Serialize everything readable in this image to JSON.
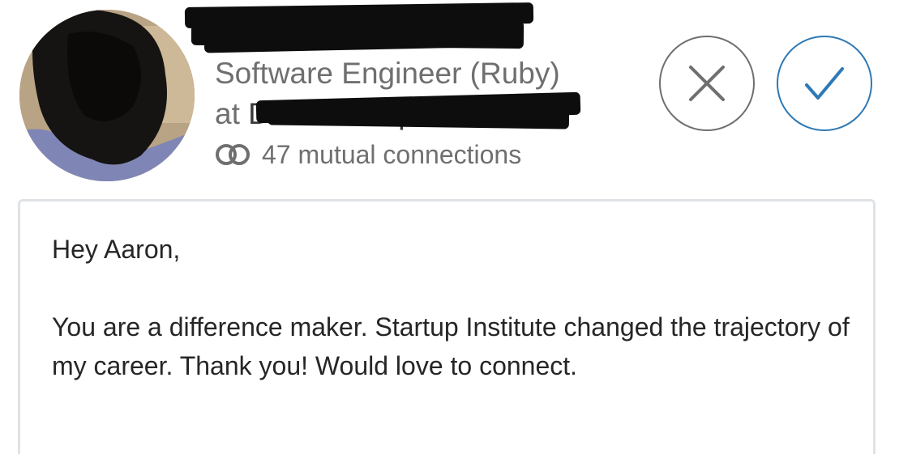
{
  "request": {
    "title_line1": "Software Engineer (Ruby)",
    "title_line2_prefix": "at ",
    "company": "Deluxe Corporation",
    "mutual_connections": "47 mutual connections",
    "mutual_icon": "mutual-connections-icon"
  },
  "actions": {
    "decline_icon": "close-icon",
    "accept_icon": "checkmark-icon",
    "decline_color": "#6f6f6f",
    "accept_color": "#2e79b5"
  },
  "message": {
    "greeting": "Hey Aaron,",
    "body": "You are a difference maker. Startup Institute changed the trajectory of my career. Thank you! Would love to connect."
  },
  "colors": {
    "text_secondary": "#6f6f6f",
    "text_primary": "#262626",
    "accent": "#2e79b5",
    "card_border": "#dfe3e8"
  }
}
